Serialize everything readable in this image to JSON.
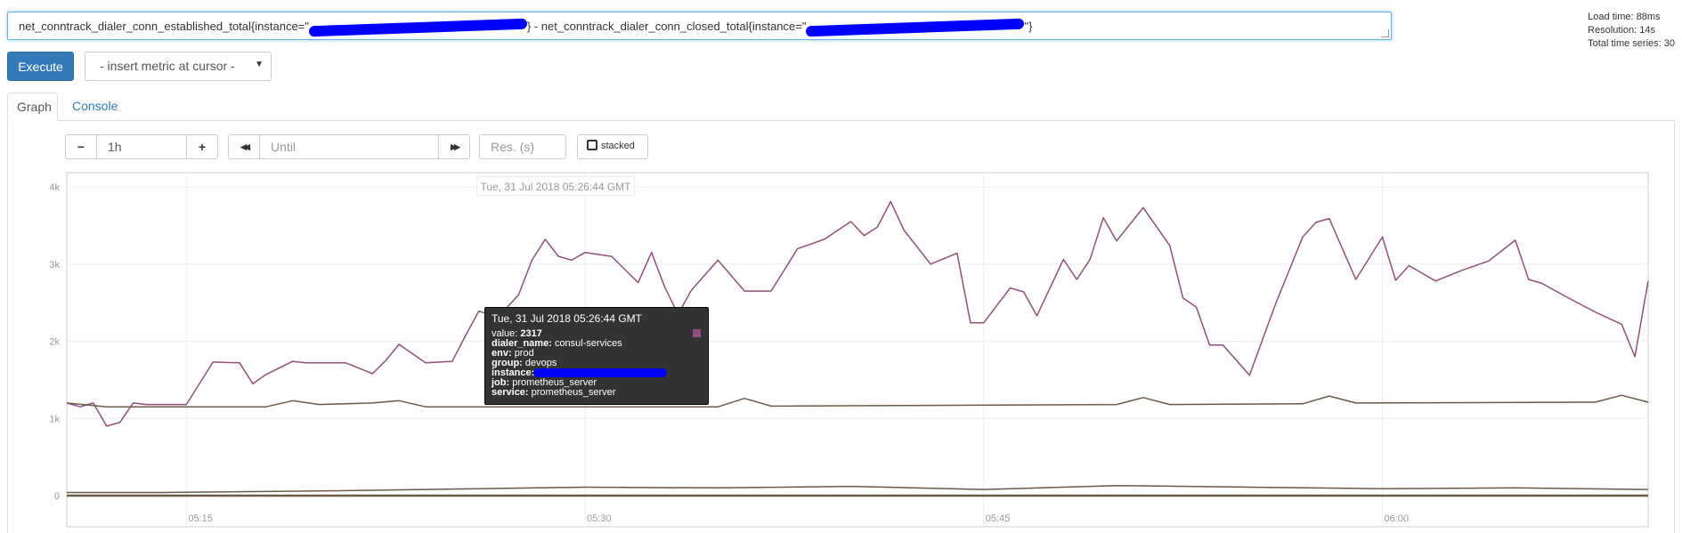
{
  "query": {
    "part1": "net_conntrack_dialer_conn_established_total{instance=\"",
    "part2": "} - net_conntrack_dialer_conn_closed_total{instance=\"",
    "part3": "\"}"
  },
  "stats": {
    "load_time": "Load time: 88ms",
    "resolution": "Resolution: 14s",
    "total_series": "Total time series: 30"
  },
  "execute_label": "Execute",
  "insert_metric_label": "- insert metric at cursor -",
  "tabs": {
    "graph": "Graph",
    "console": "Console"
  },
  "controls": {
    "minus": "−",
    "range": "1h",
    "plus": "+",
    "back_icon": "◀◀",
    "until_placeholder": "Until",
    "forward_icon": "▶▶",
    "res_placeholder": "Res. (s)",
    "stacked_label": "stacked"
  },
  "hover_time": "Tue, 31 Jul 2018 05:26:44 GMT",
  "tooltip": {
    "date": "Tue, 31 Jul 2018 05:26:44 GMT",
    "value_label": "value:",
    "value": "2317",
    "dialer_name_label": "dialer_name:",
    "dialer_name": "consul-services",
    "env_label": "env:",
    "env": "prod",
    "group_label": "group:",
    "group": "devops",
    "instance_label": "instance:",
    "job_label": "job:",
    "job": "prometheus_server",
    "service_label": "service:",
    "service": "prometheus_server"
  },
  "colors": {
    "accent": "#337ab7",
    "series_purple": "#91507a",
    "series_brown": "#6b5a46",
    "redaction": "#0000ff"
  },
  "chart_data": {
    "type": "line",
    "ylim": [
      0,
      4100
    ],
    "xlim": [
      "05:10:30",
      "06:10:00"
    ],
    "ytick_labels": [
      "0",
      "1k",
      "2k",
      "3k",
      "4k"
    ],
    "ytick_values": [
      0,
      1000,
      2000,
      3000,
      4000
    ],
    "xtick_labels": [
      "05:15",
      "05:30",
      "05:45",
      "06:00"
    ],
    "xtick_values": [
      "05:15",
      "05:30",
      "05:45",
      "06:00"
    ],
    "grid": true,
    "series": [
      {
        "color": "#91507a",
        "x": [
          "05:10:30",
          "05:11:00",
          "05:11:30",
          "05:12:00",
          "05:12:30",
          "05:13:00",
          "05:13:30",
          "05:14:00",
          "05:15:00",
          "05:16:00",
          "05:17:00",
          "05:17:30",
          "05:18:00",
          "05:19:00",
          "05:19:30",
          "05:20:00",
          "05:21:00",
          "05:22:00",
          "05:22:30",
          "05:23:00",
          "05:24:00",
          "05:25:00",
          "05:25:30",
          "05:26:00",
          "05:26:44",
          "05:27:30",
          "05:28:00",
          "05:28:30",
          "05:29:00",
          "05:29:30",
          "05:30:00",
          "05:31:00",
          "05:32:00",
          "05:32:30",
          "05:33:00",
          "05:33:30",
          "05:34:00",
          "05:35:00",
          "05:36:00",
          "05:37:00",
          "05:38:00",
          "05:39:00",
          "05:40:00",
          "05:40:30",
          "05:41:00",
          "05:41:30",
          "05:42:00",
          "05:43:00",
          "05:44:00",
          "05:44:30",
          "05:45:00",
          "05:46:00",
          "05:46:30",
          "05:47:00",
          "05:48:00",
          "05:48:30",
          "05:49:00",
          "05:49:30",
          "05:50:00",
          "05:51:00",
          "05:52:00",
          "05:52:30",
          "05:53:00",
          "05:53:30",
          "05:54:00",
          "05:55:00",
          "05:56:00",
          "05:57:00",
          "05:57:30",
          "05:58:00",
          "05:59:00",
          "06:00:00",
          "06:00:30",
          "06:01:00",
          "06:02:00",
          "06:03:00",
          "06:04:00",
          "06:05:00",
          "06:05:30",
          "06:06:00",
          "06:07:00",
          "06:08:00",
          "06:09:00",
          "06:09:30",
          "06:10:00"
        ],
        "values": [
          1200,
          1150,
          1200,
          900,
          950,
          1200,
          1180,
          1180,
          1180,
          1730,
          1720,
          1450,
          1570,
          1740,
          1720,
          1720,
          1720,
          1580,
          1750,
          1960,
          1720,
          1740,
          2070,
          2390,
          2317,
          2600,
          3050,
          3320,
          3100,
          3050,
          3150,
          3100,
          2760,
          3150,
          2700,
          2350,
          2660,
          3050,
          2650,
          2650,
          3200,
          3320,
          3550,
          3370,
          3480,
          3810,
          3440,
          3000,
          3140,
          2240,
          2240,
          2690,
          2640,
          2330,
          3060,
          2800,
          3060,
          3600,
          3300,
          3730,
          3240,
          2560,
          2440,
          1950,
          1950,
          1560,
          2500,
          3350,
          3540,
          3590,
          2800,
          3350,
          2790,
          2980,
          2780,
          2920,
          3040,
          3310,
          2800,
          2750,
          2560,
          2380,
          2220,
          1800,
          2780
        ]
      },
      {
        "color": "#6b5a46",
        "x": [
          "05:10:30",
          "05:12:00",
          "05:13:00",
          "05:14:00",
          "05:18:00",
          "05:19:00",
          "05:20:00",
          "05:22:00",
          "05:23:00",
          "05:24:00",
          "05:35:00",
          "05:36:00",
          "05:37:00",
          "05:50:00",
          "05:51:00",
          "05:52:00",
          "05:57:00",
          "05:58:00",
          "05:59:00",
          "06:08:00",
          "06:09:00",
          "06:10:00"
        ],
        "values": [
          1200,
          1150,
          1150,
          1150,
          1150,
          1230,
          1180,
          1200,
          1230,
          1150,
          1150,
          1260,
          1160,
          1180,
          1270,
          1180,
          1190,
          1290,
          1200,
          1210,
          1300,
          1210
        ]
      },
      {
        "color": "#6b5a46",
        "x": [
          "05:10:30",
          "05:14:00",
          "05:20:00",
          "05:26:00",
          "05:30:00",
          "05:35:00",
          "05:40:00",
          "05:45:00",
          "05:50:00",
          "05:55:00",
          "06:00:00",
          "06:05:00",
          "06:10:00"
        ],
        "values": [
          40,
          40,
          60,
          90,
          110,
          100,
          120,
          80,
          130,
          110,
          90,
          100,
          80
        ]
      },
      {
        "color": "#6b5a46",
        "x": [
          "05:10:30",
          "06:10:00"
        ],
        "values": [
          0,
          0
        ]
      }
    ]
  }
}
